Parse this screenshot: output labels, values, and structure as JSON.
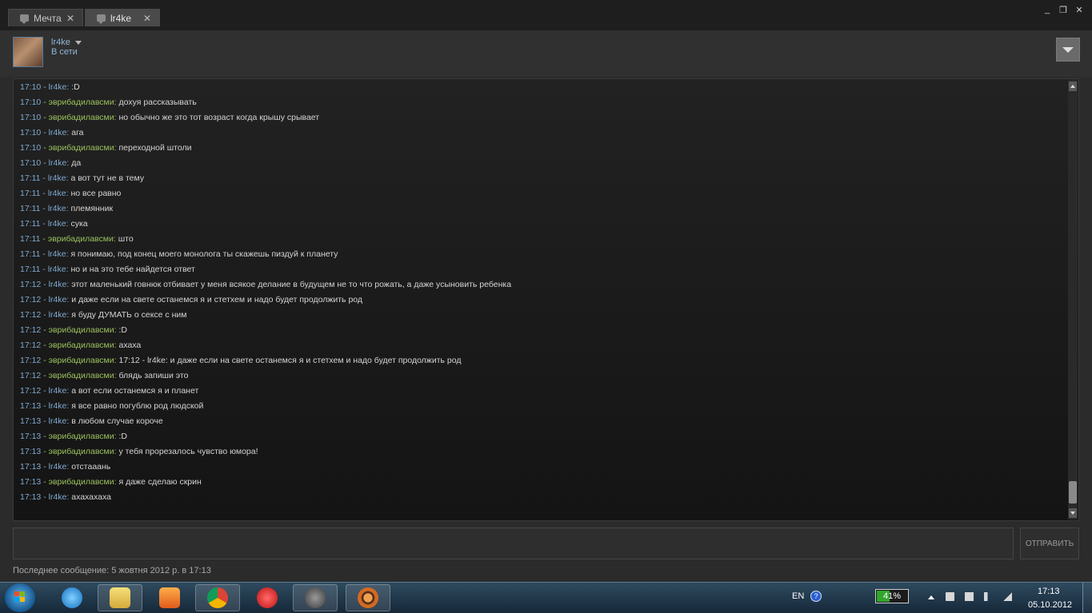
{
  "tabs": [
    {
      "label": "Мечта",
      "close": "✕"
    },
    {
      "label": "lr4ke",
      "close": "✕"
    }
  ],
  "window": {
    "minimize": "_",
    "restore": "❐",
    "close": "✕"
  },
  "header": {
    "username": "lr4ke",
    "status": "В сети"
  },
  "messages": [
    {
      "time": "17:10",
      "author": "lr4ke",
      "text": ":D",
      "is_me": true
    },
    {
      "time": "17:10",
      "author": "эврибадилавсми",
      "text": "дохуя рассказывать",
      "is_me": false
    },
    {
      "time": "17:10",
      "author": "эврибадилавсми",
      "text": "но обычно же это тот возраст когда крышу срывает",
      "is_me": false
    },
    {
      "time": "17:10",
      "author": "lr4ke",
      "text": "ага",
      "is_me": true
    },
    {
      "time": "17:10",
      "author": "эврибадилавсми",
      "text": "переходной штоли",
      "is_me": false
    },
    {
      "time": "17:10",
      "author": "lr4ke",
      "text": "да",
      "is_me": true
    },
    {
      "time": "17:11",
      "author": "lr4ke",
      "text": "а вот тут не в тему",
      "is_me": true
    },
    {
      "time": "17:11",
      "author": "lr4ke",
      "text": "но все равно",
      "is_me": true
    },
    {
      "time": "17:11",
      "author": "lr4ke",
      "text": "племянник",
      "is_me": true
    },
    {
      "time": "17:11",
      "author": "lr4ke",
      "text": "сука",
      "is_me": true
    },
    {
      "time": "17:11",
      "author": "эврибадилавсми",
      "text": "што",
      "is_me": false
    },
    {
      "time": "17:11",
      "author": "lr4ke",
      "text": "я понимаю, под конец моего монолога ты скажешь пиздуй к планету",
      "is_me": true
    },
    {
      "time": "17:11",
      "author": "lr4ke",
      "text": "но и на это тебе найдется ответ",
      "is_me": true
    },
    {
      "time": "17:12",
      "author": "lr4ke",
      "text": "этот маленький говнюк отбивает у меня всякое делание в будущем не то что рожать, а даже усыновить ребенка",
      "is_me": true
    },
    {
      "time": "17:12",
      "author": "lr4ke",
      "text": "и даже если на свете останемся я и стетхем и надо будет продолжить род",
      "is_me": true
    },
    {
      "time": "17:12",
      "author": "lr4ke",
      "text": "я буду ДУМАТЬ о сексе с ним",
      "is_me": true
    },
    {
      "time": "17:12",
      "author": "эврибадилавсми",
      "text": ":D",
      "is_me": false
    },
    {
      "time": "17:12",
      "author": "эврибадилавсми",
      "text": "ахаха",
      "is_me": false
    },
    {
      "time": "17:12",
      "author": "эврибадилавсми",
      "text": "17:12 - lr4ke: и даже если на свете останемся я и стетхем и надо будет продолжить род",
      "is_me": false
    },
    {
      "time": "17:12",
      "author": "эврибадилавсми",
      "text": "блядь запиши это",
      "is_me": false
    },
    {
      "time": "17:12",
      "author": "lr4ke",
      "text": "а вот если останемся я и планет",
      "is_me": true
    },
    {
      "time": "17:13",
      "author": "lr4ke",
      "text": "я все равно погублю род людской",
      "is_me": true
    },
    {
      "time": "17:13",
      "author": "lr4ke",
      "text": "в любом случае короче",
      "is_me": true
    },
    {
      "time": "17:13",
      "author": "эврибадилавсми",
      "text": ":D",
      "is_me": false
    },
    {
      "time": "17:13",
      "author": "эврибадилавсми",
      "text": "у тебя прорезалось чувство юмора!",
      "is_me": false
    },
    {
      "time": "17:13",
      "author": "lr4ke",
      "text": "отстааань",
      "is_me": true
    },
    {
      "time": "17:13",
      "author": "эврибадилавсми",
      "text": "я даже сделаю скрин",
      "is_me": false
    },
    {
      "time": "17:13",
      "author": "lr4ke",
      "text": "ахахахаха",
      "is_me": true
    }
  ],
  "chat_colors": {
    "me": "#7fa9cf",
    "other": "#9bc15c",
    "text": "#d4d4d4"
  },
  "composer": {
    "send_label": "ОТПРАВИТЬ",
    "value": ""
  },
  "footer": {
    "last_message": "Последнее сообщение: 5 жовтня 2012 р. в 17:13"
  },
  "taskbar": {
    "items": [
      "ie-icon",
      "explorer-icon",
      "media-player-icon",
      "chrome-icon",
      "red-app-icon",
      "steam-icon",
      "tf2-icon"
    ],
    "lang": "EN",
    "battery_percent": 41,
    "battery_label": "41%",
    "time": "17:13",
    "date": "05.10.2012"
  }
}
